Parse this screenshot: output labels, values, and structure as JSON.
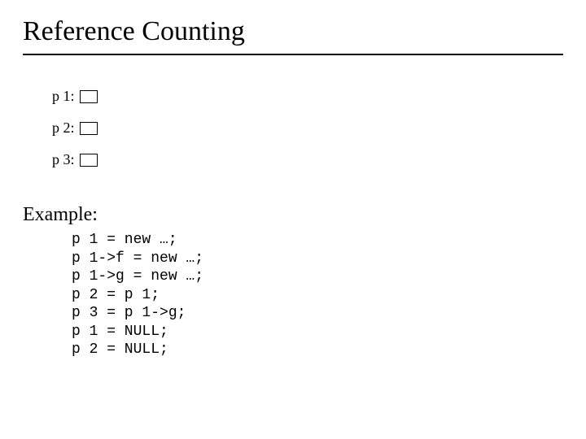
{
  "title": "Reference Counting",
  "pointers": {
    "p1_label": "p 1:",
    "p2_label": "p 2:",
    "p3_label": "p 3:"
  },
  "example_heading": "Example:",
  "code": {
    "line1": "p 1 = new …;",
    "line2": "p 1->f = new …;",
    "line3": "p 1->g = new …;",
    "line4": "p 2 = p 1;",
    "line5": "p 3 = p 1->g;",
    "line6": "p 1 = NULL;",
    "line7": "p 2 = NULL;"
  }
}
